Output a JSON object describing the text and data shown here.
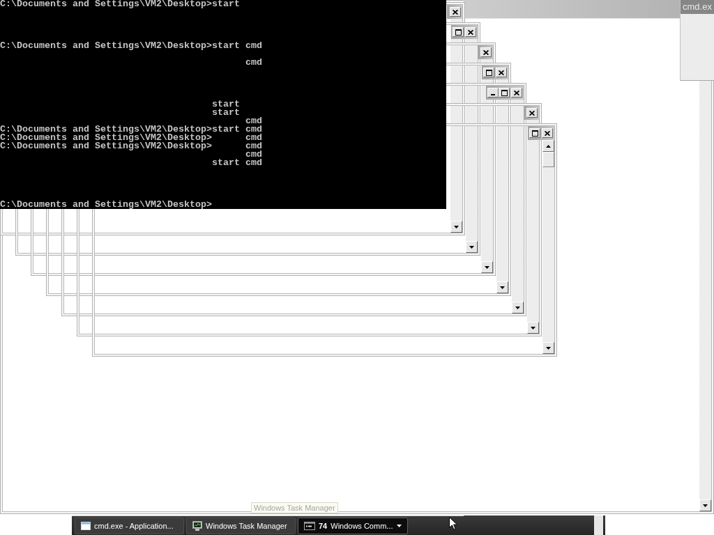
{
  "console": {
    "output": "C:\\Documents and Settings\\VM2\\Desktop>start\n\n\n\n\nC:\\Documents and Settings\\VM2\\Desktop>start cmd\n\n                                            cmd\n\n\n\n\n                                      start\n                                      start\n                                            cmd\nC:\\Documents and Settings\\VM2\\Desktop>start cmd\nC:\\Documents and Settings\\VM2\\Desktop>      cmd\nC:\\Documents and Settings\\VM2\\Desktop>      cmd\n                                            cmd\n                                      start cmd\n\n\n\n\nC:\\Documents and Settings\\VM2\\Desktop>"
  },
  "corner_window": {
    "title": "cmd.ex"
  },
  "cascade_windows": [
    {
      "buttons": [
        {
          "kind": "close"
        }
      ]
    },
    {
      "buttons": [
        {
          "kind": "maximize"
        },
        {
          "kind": "close"
        }
      ]
    },
    {
      "buttons": [
        {
          "kind": "close"
        }
      ]
    },
    {
      "buttons": [
        {
          "kind": "maximize"
        },
        {
          "kind": "close"
        }
      ]
    },
    {
      "buttons": [
        {
          "kind": "minimize"
        },
        {
          "kind": "maximize"
        },
        {
          "kind": "close"
        }
      ]
    },
    {
      "buttons": [
        {
          "kind": "close"
        }
      ]
    },
    {
      "buttons": [
        {
          "kind": "maximize"
        },
        {
          "kind": "close"
        }
      ]
    }
  ],
  "tooltip": {
    "text": "Windows Task Manager"
  },
  "taskbar": {
    "buttons": [
      {
        "kind": "window",
        "label": "cmd.exe - Application...",
        "selected": false
      },
      {
        "kind": "task-manager",
        "label": "Windows Task Manager",
        "selected": false
      },
      {
        "kind": "console",
        "count": "74",
        "label": "Windows Comm...",
        "selected": true
      }
    ]
  }
}
